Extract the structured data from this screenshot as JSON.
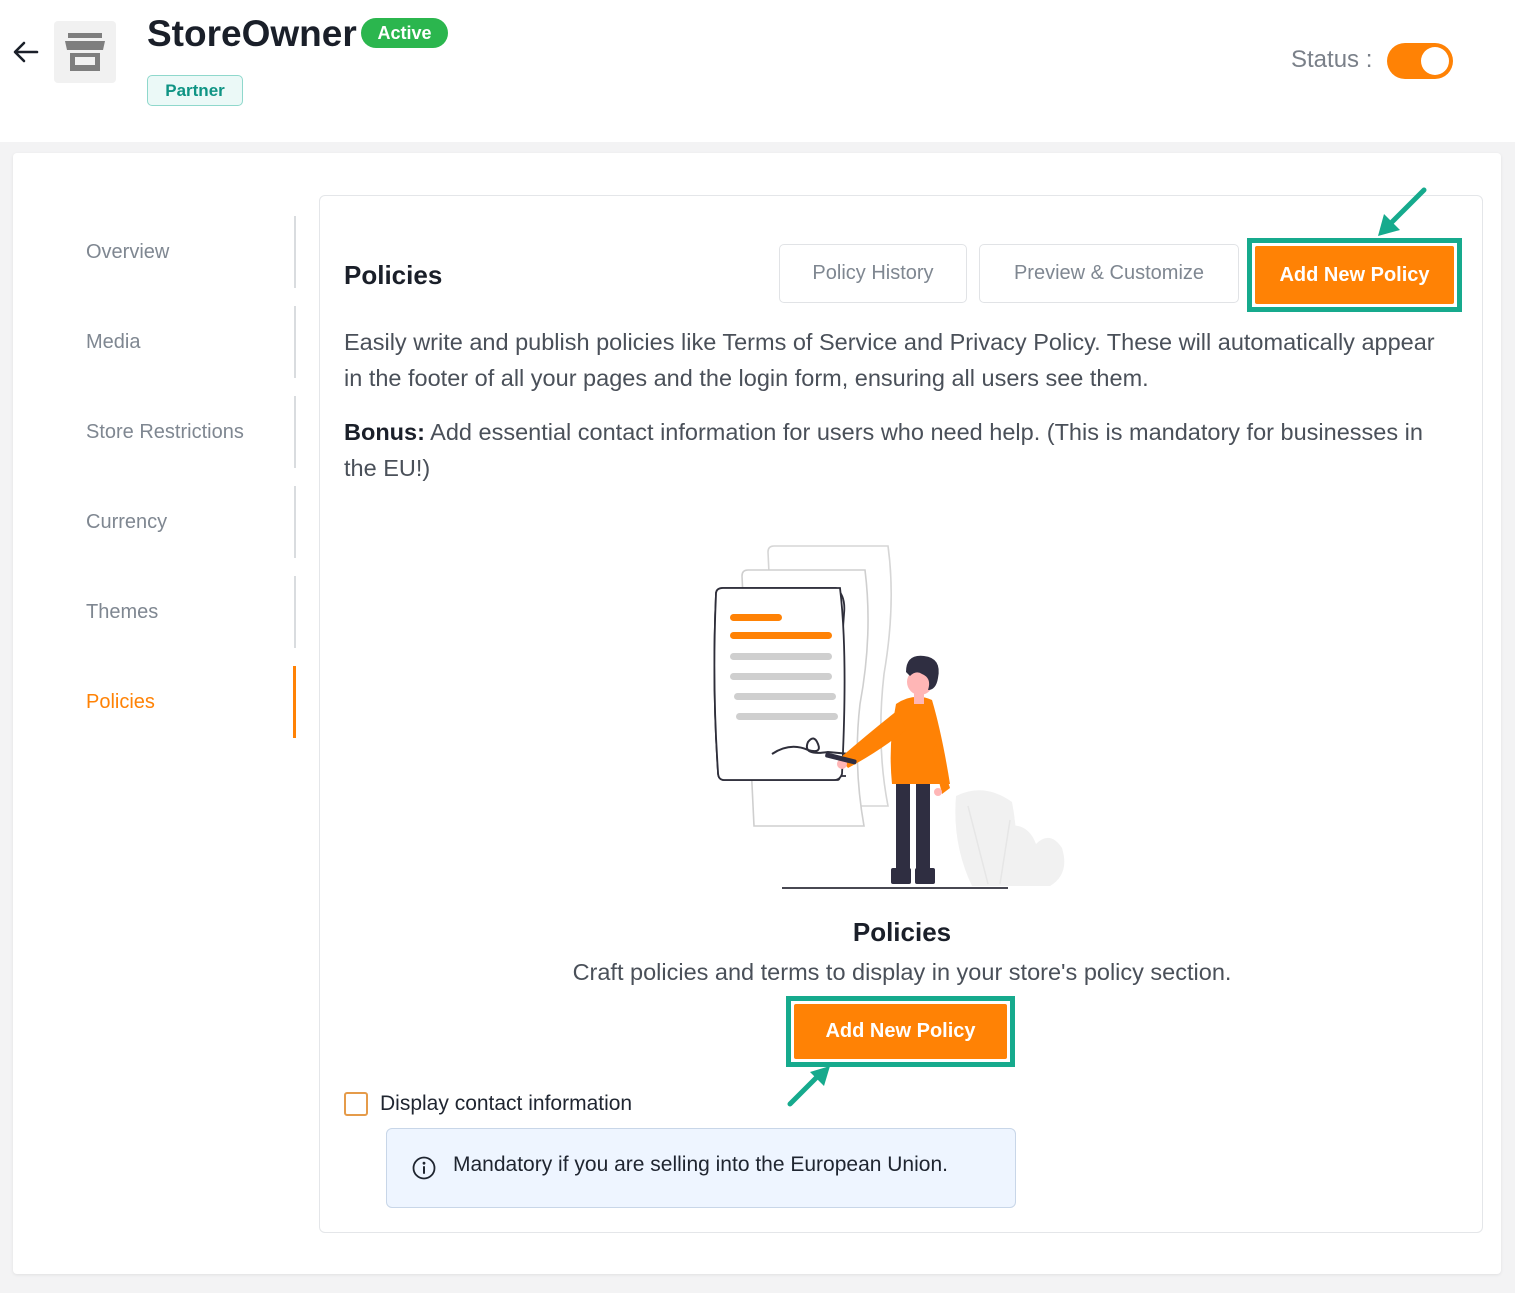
{
  "header": {
    "store_name": "StoreOwner",
    "active_badge": "Active",
    "partner_badge": "Partner",
    "status_label": "Status :",
    "status_on": true,
    "back_icon": "arrow-left-icon",
    "store_icon": "storefront-icon"
  },
  "sidebar": {
    "items": [
      {
        "label": "Overview",
        "active": false
      },
      {
        "label": "Media",
        "active": false
      },
      {
        "label": "Store Restrictions",
        "active": false
      },
      {
        "label": "Currency",
        "active": false
      },
      {
        "label": "Themes",
        "active": false
      },
      {
        "label": "Policies",
        "active": true
      }
    ]
  },
  "main": {
    "title": "Policies",
    "policy_history_label": "Policy History",
    "preview_customize_label": "Preview & Customize",
    "add_policy_label": "Add New Policy",
    "description": "Easily write and publish policies like Terms of Service and Privacy Policy. These will automatically appear in the footer of all your pages and the login form, ensuring all users see them.",
    "bonus_label": "Bonus:",
    "bonus_text": "Add essential contact information for users who need help. (This is mandatory for businesses in the EU!)",
    "empty_state": {
      "title": "Policies",
      "subtitle": "Craft policies and terms to display in your store's policy section.",
      "button_label": "Add New Policy"
    },
    "contact_checkbox_label": "Display contact information",
    "contact_checked": false,
    "info_text": "Mandatory if you are selling into the European Union."
  },
  "colors": {
    "accent": "#ff8205",
    "highlight": "#16aa8d",
    "active_badge": "#2bb64e",
    "info_bg": "#eef5ff"
  }
}
